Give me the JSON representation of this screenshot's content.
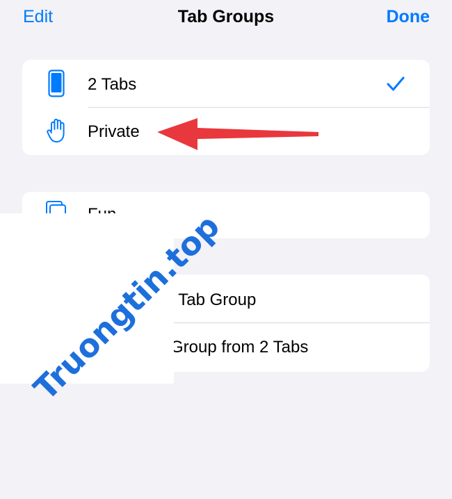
{
  "nav": {
    "edit_label": "Edit",
    "title": "Tab Groups",
    "done_label": "Done"
  },
  "groups": [
    {
      "label": "2 Tabs",
      "icon": "phone-icon",
      "selected": true
    },
    {
      "label": "Private",
      "icon": "hand-icon",
      "selected": false
    }
  ],
  "user_groups": [
    {
      "label": "Fun",
      "icon": "tabs-icon"
    }
  ],
  "actions": [
    {
      "label": "y Tab Group"
    },
    {
      "label": "Group from 2 Tabs"
    }
  ],
  "watermark": "Truongtin.top",
  "colors": {
    "accent": "#007aff",
    "arrow": "#e8383d",
    "background": "#f2f2f7"
  }
}
